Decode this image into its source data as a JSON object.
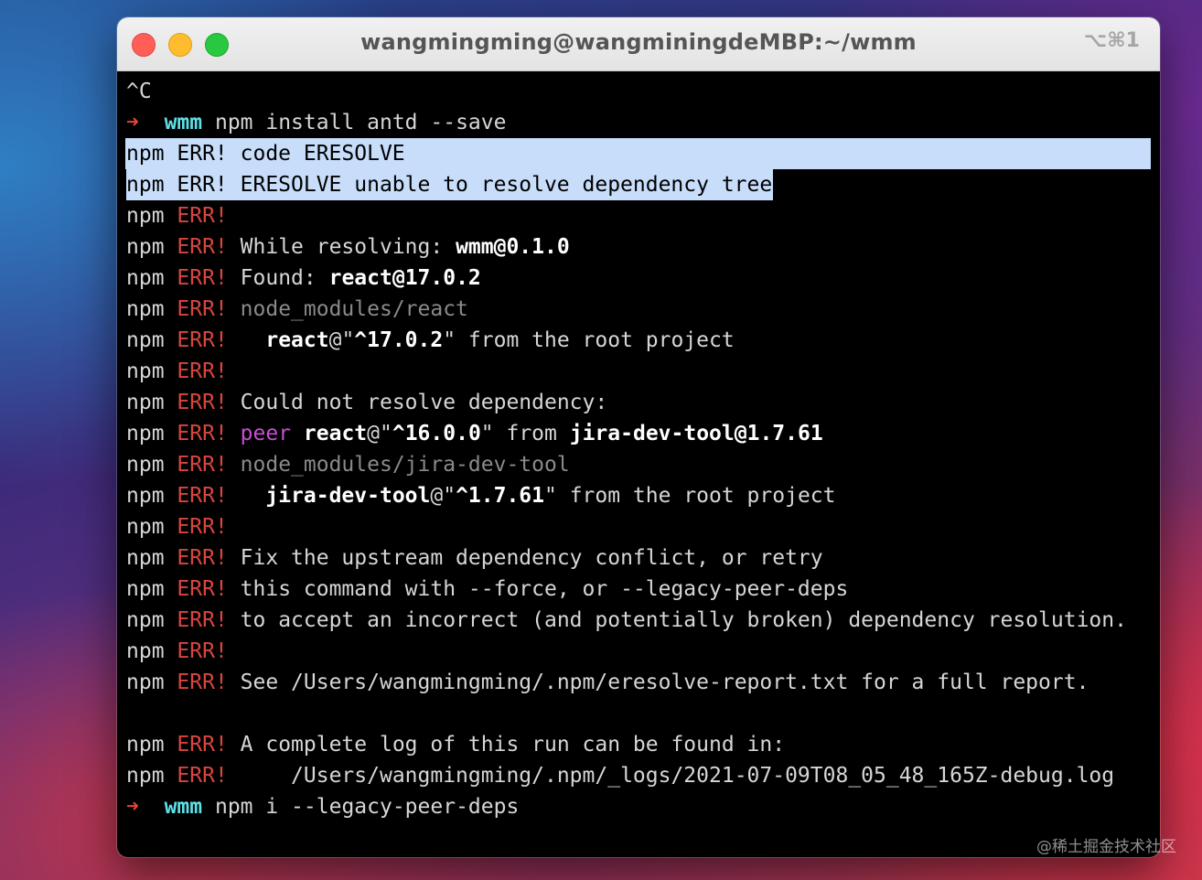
{
  "window": {
    "title": "wangmingming@wangminingdeMBP:~/wmm",
    "shortcut": "⌥⌘1"
  },
  "prompt": {
    "arrow": "➜",
    "dir": "wmm"
  },
  "terminal": {
    "interrupt": "^C",
    "cmd1": "npm install antd --save",
    "npm": "npm",
    "err": "ERR!",
    "sel1": "npm ERR! code ERESOLVE",
    "sel2": "npm ERR! ERESOLVE unable to resolve dependency tree",
    "while_resolving": "While resolving: ",
    "wmm_pkg": "wmm",
    "wmm_ver": "@0.1.0",
    "found": "Found: ",
    "react_pkg": "react",
    "react_found_ver": "@17.0.2",
    "node_modules_react": "node_modules/react",
    "react_at": "@\"",
    "react_req_ver": "^17.0.2",
    "quote_from_root": "\" from the root project",
    "could_not": "Could not resolve dependency:",
    "peer": "peer",
    "react_peer_ver": "^16.0.0",
    "quote_from": "\" from ",
    "jira_pkg": "jira-dev-tool",
    "jira_ver": "@1.7.61",
    "node_modules_jira": "node_modules/jira-dev-tool",
    "jira_req_ver": "^1.7.61",
    "fix1": "Fix the upstream dependency conflict, or retry",
    "fix2": "this command with --force, or --legacy-peer-deps",
    "fix3": "to accept an incorrect (and potentially broken) dependency resolution.",
    "see_report": "See /Users/wangmingming/.npm/eresolve-report.txt for a full report.",
    "log_intro": "A complete log of this run can be found in:",
    "log_path": "/Users/wangmingming/.npm/_logs/2021-07-09T08_05_48_165Z-debug.log",
    "cmd2": "npm i --legacy-peer-deps"
  },
  "watermark": "@稀土掘金技术社区"
}
